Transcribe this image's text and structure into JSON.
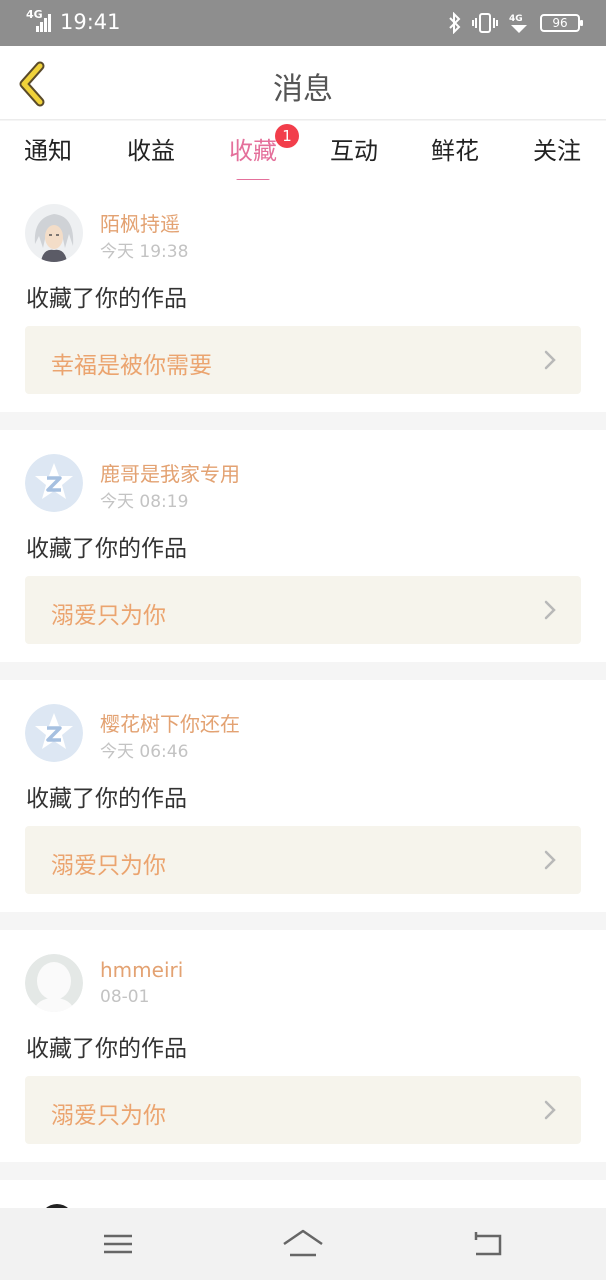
{
  "status_bar": {
    "network": "4G",
    "time": "19:41",
    "icons": [
      "bluetooth-icon",
      "vibrate-icon",
      "4g-wifi-icon"
    ],
    "battery": "96"
  },
  "header": {
    "title": "消息"
  },
  "tabs": [
    {
      "label": "通知",
      "active": false
    },
    {
      "label": "收益",
      "active": false
    },
    {
      "label": "收藏",
      "active": true,
      "badge": "1"
    },
    {
      "label": "互动",
      "active": false
    },
    {
      "label": "鲜花",
      "active": false
    },
    {
      "label": "关注",
      "active": false
    }
  ],
  "messages": [
    {
      "username": "陌枫持遥",
      "time": "今天 19:38",
      "action": "收藏了你的作品",
      "work_title": "幸福是被你需要",
      "avatar": "anime-avatar"
    },
    {
      "username": "鹿哥是我家专用",
      "time": "今天 08:19",
      "action": "收藏了你的作品",
      "work_title": "溺爱只为你",
      "avatar": "default-z-avatar"
    },
    {
      "username": "樱花树下你还在",
      "time": "今天 06:46",
      "action": "收藏了你的作品",
      "work_title": "溺爱只为你",
      "avatar": "default-z-avatar"
    },
    {
      "username": "hmmeiri",
      "time": "08-01",
      "action": "收藏了你的作品",
      "work_title": "溺爱只为你",
      "avatar": "default-person-avatar"
    }
  ],
  "colors": {
    "accent": "#e4709b",
    "username": "#e3a272",
    "work_title": "#eba46f",
    "badge": "#f23e4b"
  },
  "nav": [
    "menu-icon",
    "home-icon",
    "back-nav-icon"
  ]
}
